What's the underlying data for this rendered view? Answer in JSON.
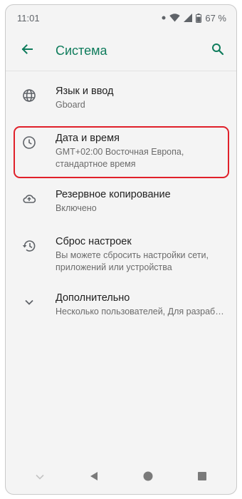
{
  "status_bar": {
    "time": "11:01",
    "battery": "67 %",
    "icons": [
      "dot-icon",
      "wifi-icon",
      "signal-icon",
      "battery-icon"
    ]
  },
  "app_bar": {
    "title": "Система",
    "back_icon": "arrow-left-icon",
    "search_icon": "search-icon"
  },
  "colors": {
    "accent": "#0f7c5c",
    "highlight": "#e0202a",
    "background": "#f4f4f4"
  },
  "settings_items": [
    {
      "icon": "globe-icon",
      "label": "Язык и ввод",
      "sub": "Gboard"
    },
    {
      "icon": "clock-icon",
      "label": "Дата и время",
      "sub": "GMT+02:00 Восточная Европа, стандартное время",
      "highlighted": true
    },
    {
      "icon": "cloud-backup-icon",
      "label": "Резервное копирование",
      "sub": "Включено"
    },
    {
      "icon": "restore-icon",
      "label": "Сброс настроек",
      "sub": "Вы можете сбросить настройки сети, приложений или устройства"
    },
    {
      "icon": "chevron-down-icon",
      "label": "Дополнительно",
      "sub": "Несколько пользователей, Для разработчиков"
    }
  ],
  "nav_bar": {
    "buttons": [
      "chevron-down-icon",
      "back-triangle-icon",
      "home-circle-icon",
      "recents-square-icon"
    ]
  }
}
